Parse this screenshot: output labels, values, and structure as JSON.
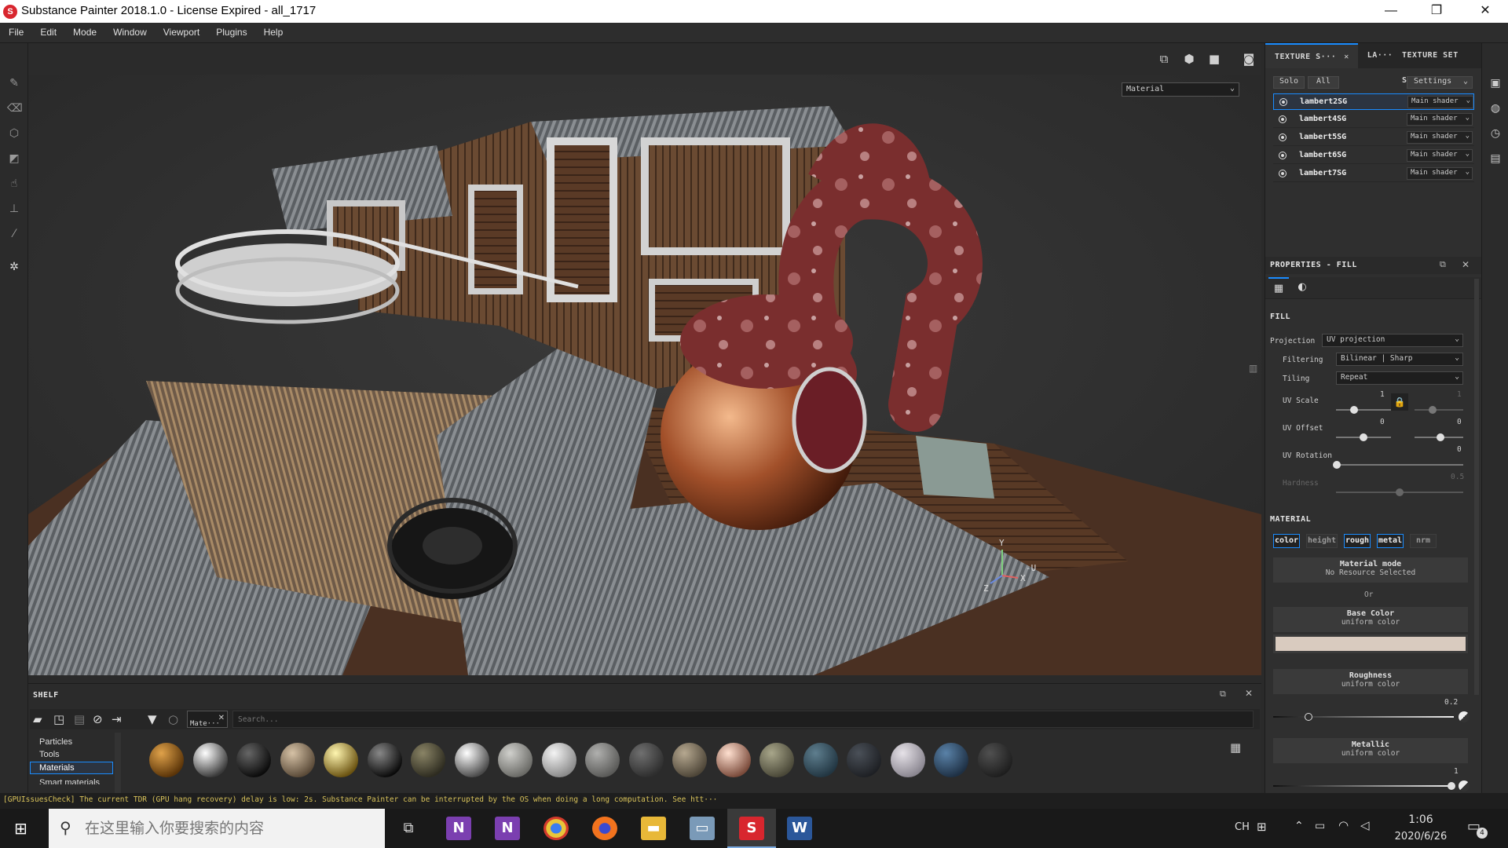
{
  "window": {
    "title": "Substance Painter 2018.1.0 - License Expired - all_1717",
    "minimize": "—",
    "restore": "❐",
    "close": "✕"
  },
  "menu": [
    "File",
    "Edit",
    "Mode",
    "Window",
    "Viewport",
    "Plugins",
    "Help"
  ],
  "viewport": {
    "channel_select": "Material",
    "axis_labels": {
      "y": "Y",
      "x": "X",
      "z": "Z",
      "u": "-U"
    }
  },
  "texture_sets": {
    "tabs": [
      "TEXTURE S···",
      "LA···",
      "TEXTURE SET S···"
    ],
    "solo": "Solo",
    "all": "All",
    "settings": "Settings",
    "rows": [
      {
        "name": "lambert2SG",
        "shader": "Main shader",
        "selected": true
      },
      {
        "name": "lambert4SG",
        "shader": "Main shader",
        "selected": false
      },
      {
        "name": "lambert5SG",
        "shader": "Main shader",
        "selected": false
      },
      {
        "name": "lambert6SG",
        "shader": "Main shader",
        "selected": false
      },
      {
        "name": "lambert7SG",
        "shader": "Main shader",
        "selected": false
      }
    ]
  },
  "properties": {
    "title": "PROPERTIES - FILL",
    "fill_header": "FILL",
    "projection_label": "Projection",
    "projection_value": "UV projection",
    "filtering_label": "Filtering",
    "filtering_value": "Bilinear | Sharp",
    "tiling_label": "Tiling",
    "tiling_value": "Repeat",
    "uv_scale_label": "UV Scale",
    "uv_scale_value": "1",
    "uv_scale_value2": "1",
    "uv_offset_label": "UV Offset",
    "uv_offset_value": "0",
    "uv_offset_value2": "0",
    "uv_rotation_label": "UV Rotation",
    "uv_rotation_value": "0",
    "hardness_label": "Hardness",
    "hardness_value": "0.5",
    "material_header": "MATERIAL",
    "channels": [
      {
        "label": "color",
        "active": true
      },
      {
        "label": "height",
        "active": false
      },
      {
        "label": "rough",
        "active": true
      },
      {
        "label": "metal",
        "active": true
      },
      {
        "label": "nrm",
        "active": false
      }
    ],
    "material_mode": "Material mode",
    "no_resource": "No Resource Selected",
    "or": "Or",
    "base_color": "Base Color",
    "base_color_sub": "uniform color",
    "base_color_hex": "#d9cbbf",
    "roughness": "Roughness",
    "roughness_sub": "uniform color",
    "roughness_value": "0.2",
    "metallic": "Metallic",
    "metallic_sub": "uniform color",
    "metallic_value": "1"
  },
  "shelf": {
    "title": "SHELF",
    "filter_tag": "Mate···",
    "search_placeholder": "Search...",
    "categories": [
      "Particles",
      "Tools",
      "Materials",
      "Smart materials"
    ],
    "selected_category": "Materials",
    "swatches": [
      {
        "c1": "#e0a24a",
        "c2": "#5a3408"
      },
      {
        "c1": "#ffffff",
        "c2": "#3a3a3a"
      },
      {
        "c1": "#666666",
        "c2": "#0b0b0b"
      },
      {
        "c1": "#d6c2a6",
        "c2": "#5a4a38"
      },
      {
        "c1": "#fff6b0",
        "c2": "#6a5210"
      },
      {
        "c1": "#888888",
        "c2": "#0a0a0a"
      },
      {
        "c1": "#8a8466",
        "c2": "#2e2c20"
      },
      {
        "c1": "#ffffff",
        "c2": "#4a4a4a"
      },
      {
        "c1": "#d0d0cc",
        "c2": "#6a6a66"
      },
      {
        "c1": "#f4f4f4",
        "c2": "#8a8a8a"
      },
      {
        "c1": "#b0b0ae",
        "c2": "#5a5a58"
      },
      {
        "c1": "#707070",
        "c2": "#2e2e2e"
      },
      {
        "c1": "#b6a890",
        "c2": "#4e4638"
      },
      {
        "c1": "#ffe0d0",
        "c2": "#7a4a3a"
      },
      {
        "c1": "#a8a68a",
        "c2": "#4a4838"
      },
      {
        "c1": "#5e7e8e",
        "c2": "#223642"
      },
      {
        "c1": "#4a5058",
        "c2": "#1e2024"
      },
      {
        "c1": "#e6e2e8",
        "c2": "#8a8690"
      },
      {
        "c1": "#5a82a8",
        "c2": "#1e3044"
      },
      {
        "c1": "#505050",
        "c2": "#1e1e1e"
      }
    ]
  },
  "console": "[GPUIssuesCheck] The current TDR (GPU hang recovery) delay is low: 2s. Substance Painter can be interrupted by the OS when doing a long computation. See htt···",
  "taskbar": {
    "search_placeholder": "在这里输入你要搜索的内容",
    "ime": "CH",
    "time": "1:06",
    "date": "2020/6/26",
    "notifications": "4"
  }
}
